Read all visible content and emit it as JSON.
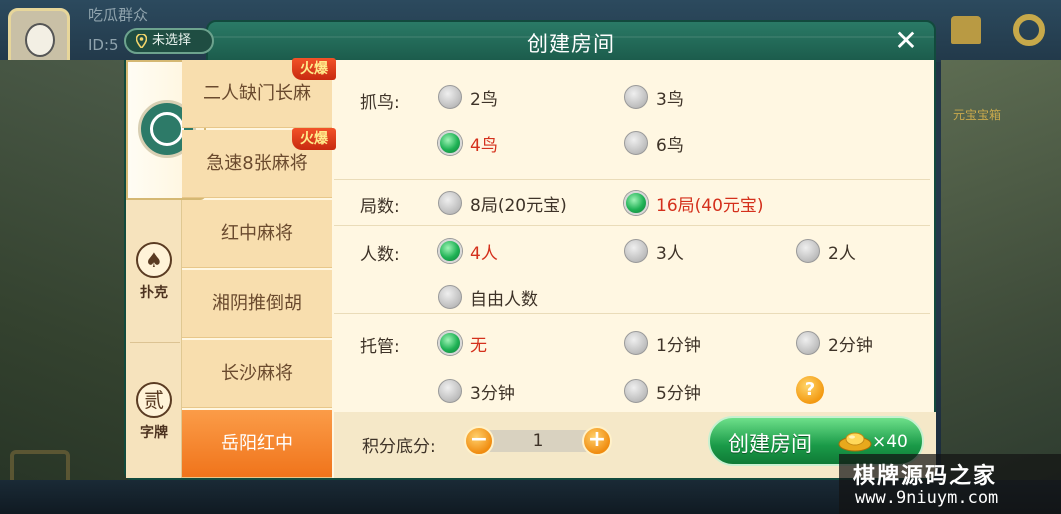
{
  "background": {
    "player_name": "吃瓜群众",
    "player_id": "ID:5",
    "chest_label": "元宝宝箱"
  },
  "dialog": {
    "title": "创建房间",
    "location": "未选择",
    "close_symbol": "✕"
  },
  "categories": [
    {
      "label": "",
      "icon": "mahjong-emblem-icon"
    },
    {
      "label": "扑克",
      "icon": "spade-icon",
      "glyph": "♠"
    },
    {
      "label": "字牌",
      "icon": "zi-character-icon",
      "glyph": "贰"
    }
  ],
  "games": [
    {
      "label": "二人缺门长麻",
      "hot": "火爆"
    },
    {
      "label": "急速8张麻将",
      "hot": "火爆"
    },
    {
      "label": "红中麻将"
    },
    {
      "label": "湘阴推倒胡"
    },
    {
      "label": "长沙麻将"
    },
    {
      "label": "岳阳红中",
      "selected": true
    }
  ],
  "options": {
    "bird": {
      "label": "抓鸟:",
      "choices": [
        "2鸟",
        "3鸟",
        "4鸟",
        "6鸟"
      ],
      "selected": "4鸟"
    },
    "rounds": {
      "label": "局数:",
      "choices": [
        "8局(20元宝)",
        "16局(40元宝)"
      ],
      "selected": "16局(40元宝)"
    },
    "players": {
      "label": "人数:",
      "choices": [
        "4人",
        "3人",
        "2人",
        "自由人数"
      ],
      "selected": "4人"
    },
    "auto": {
      "label": "托管:",
      "choices": [
        "无",
        "1分钟",
        "2分钟",
        "3分钟",
        "5分钟"
      ],
      "selected": "无",
      "help": "?"
    }
  },
  "footer": {
    "score_label": "积分底分:",
    "score_value": "1",
    "minus": "−",
    "plus": "+",
    "create_label": "创建房间",
    "cost": "×40"
  },
  "watermark": {
    "title": "棋牌源码之家",
    "url": "www.9niuym.com"
  },
  "colors": {
    "header": "#1c5c4c",
    "panel": "#fff7e2",
    "selected_text": "#d4301c",
    "selected_game": "#f0741b",
    "create_button": "#1a9a48"
  }
}
